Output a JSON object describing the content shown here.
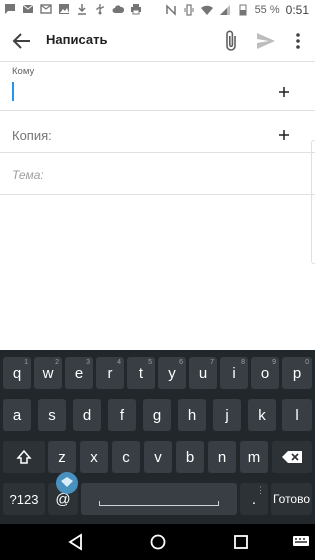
{
  "status_bar": {
    "battery_percent": "55 %",
    "time": "0:51",
    "left_icons": [
      "sms-icon",
      "mail-icon",
      "gmail-icon",
      "image-icon",
      "download-icon",
      "usb-icon",
      "cloud-icon",
      "printer-icon"
    ],
    "right_icons": [
      "nfc-icon",
      "vibrate-icon",
      "wifi-icon",
      "signal-icon",
      "battery-icon"
    ]
  },
  "app_bar": {
    "title": "Написать",
    "icons": [
      "back-arrow-icon",
      "paperclip-icon",
      "send-icon",
      "more-vert-icon"
    ]
  },
  "compose": {
    "to_label": "Кому",
    "to_value": "",
    "cc_placeholder": "Копия:",
    "subject_placeholder": "Тема:"
  },
  "keyboard": {
    "row1": [
      "q",
      "w",
      "e",
      "r",
      "t",
      "y",
      "u",
      "i",
      "o",
      "p"
    ],
    "row1_hints": [
      "1",
      "2",
      "3",
      "4",
      "5",
      "6",
      "7",
      "8",
      "9",
      "0"
    ],
    "row2": [
      "a",
      "s",
      "d",
      "f",
      "g",
      "h",
      "j",
      "k",
      "l"
    ],
    "row3": [
      "z",
      "x",
      "c",
      "v",
      "b",
      "n",
      "m"
    ],
    "symbols_key": "?123",
    "at_key": "@",
    "period_key": ".",
    "done_key": "Готово",
    "colors": {
      "background": "#21272b",
      "key": "#383e43",
      "text": "#ffffff"
    }
  },
  "nav_bar": {
    "icons": [
      "back-triangle-icon",
      "home-circle-icon",
      "recents-square-icon",
      "keyboard-switch-icon"
    ]
  }
}
